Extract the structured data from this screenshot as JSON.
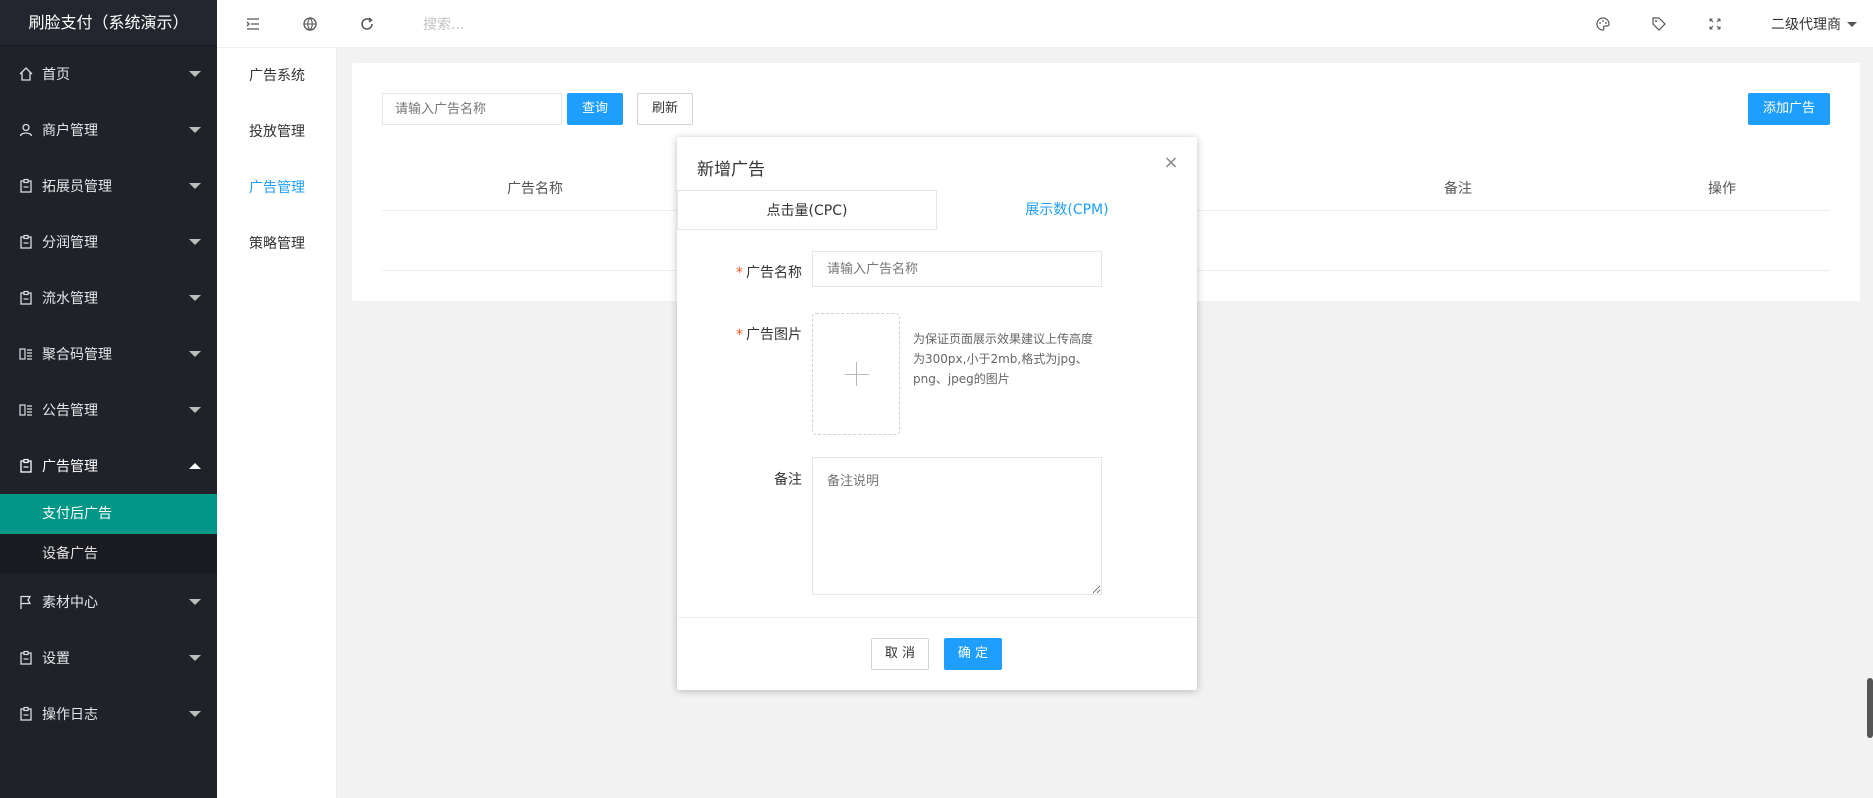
{
  "app": {
    "title": "刷脸支付（系统演示）"
  },
  "header": {
    "search_placeholder": "搜索...",
    "user_name": "二级代理商"
  },
  "sidebar": {
    "items": [
      {
        "label": "首页",
        "icon": "home-icon"
      },
      {
        "label": "商户管理",
        "icon": "user-icon"
      },
      {
        "label": "拓展员管理",
        "icon": "clipboard-icon"
      },
      {
        "label": "分润管理",
        "icon": "clipboard-icon"
      },
      {
        "label": "流水管理",
        "icon": "clipboard-icon"
      },
      {
        "label": "聚合码管理",
        "icon": "list-icon"
      },
      {
        "label": "公告管理",
        "icon": "list-icon"
      },
      {
        "label": "广告管理",
        "icon": "clipboard-icon",
        "expanded": true
      },
      {
        "label": "素材中心",
        "icon": "flag-icon"
      },
      {
        "label": "设置",
        "icon": "clipboard-icon"
      },
      {
        "label": "操作日志",
        "icon": "clipboard-icon"
      }
    ],
    "submenu": [
      {
        "label": "支付后广告",
        "active": true
      },
      {
        "label": "设备广告",
        "active": false
      }
    ]
  },
  "subnav": {
    "items": [
      {
        "label": "广告系统",
        "active": false
      },
      {
        "label": "投放管理",
        "active": false
      },
      {
        "label": "广告管理",
        "active": true
      },
      {
        "label": "策略管理",
        "active": false
      }
    ]
  },
  "toolbar": {
    "query_placeholder": "请输入广告名称",
    "query_button": "查询",
    "refresh_button": "刷新",
    "add_button": "添加广告"
  },
  "table": {
    "columns": [
      "广告名称",
      "备注",
      "操作"
    ]
  },
  "modal": {
    "title": "新增广告",
    "tabs": [
      {
        "label": "点击量(CPC)",
        "active": false
      },
      {
        "label": "展示数(CPM)",
        "active": true
      }
    ],
    "fields": {
      "name_label": "广告名称",
      "name_placeholder": "请输入广告名称",
      "image_label": "广告图片",
      "image_hint": "为保证页面展示效果建议上传高度为300px,小于2mb,格式为jpg、png、jpeg的图片",
      "remark_label": "备注",
      "remark_placeholder": "备注说明"
    },
    "required_mark": "*",
    "cancel_button": "取 消",
    "confirm_button": "确 定"
  },
  "colors": {
    "sidebar_bg": "#20222a",
    "active_green": "#009688",
    "primary_blue": "#1e9fff"
  }
}
